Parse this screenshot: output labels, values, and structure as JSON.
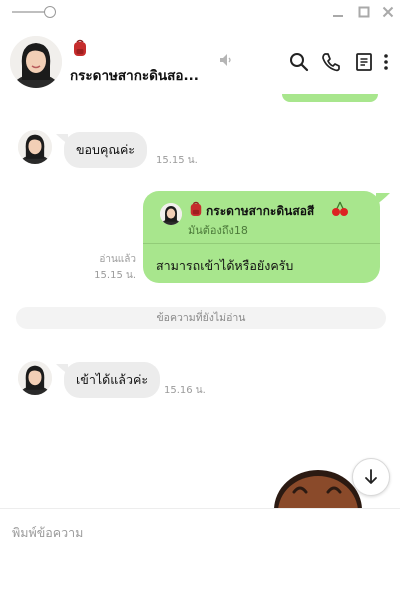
{
  "header": {
    "contact_name": "กระดาษสากะดินสอ..."
  },
  "messages": [
    {
      "direction": "in",
      "text": "ขอบคุณค่ะ",
      "time": "15.15 น."
    },
    {
      "direction": "out",
      "reply_name": "กระดาษสากะดินสอสี",
      "reply_text": "มันต้องถึง18",
      "text": "สามารถเข้าได้หรือยังครับ",
      "read_label": "อ่านแล้ว",
      "time": "15.15 น."
    },
    {
      "direction": "in",
      "text": "เข้าได้แล้วค่ะ",
      "time": "15.16 น."
    }
  ],
  "divider_text": "ข้อความที่ยังไม่อ่าน",
  "input": {
    "placeholder": "พิมพ์ข้อความ"
  },
  "colors": {
    "out_bubble": "#a8e68d",
    "in_bubble": "#ececec",
    "accent_icon": "#c62d2d"
  },
  "icons": {
    "window": [
      "minimize-icon",
      "maximize-icon",
      "close-icon"
    ],
    "header": [
      "mute-icon",
      "search-icon",
      "phone-icon",
      "notes-icon",
      "more-icon"
    ],
    "decor": [
      "backpack-icon",
      "cherry-icon",
      "arrow-down-icon"
    ]
  }
}
